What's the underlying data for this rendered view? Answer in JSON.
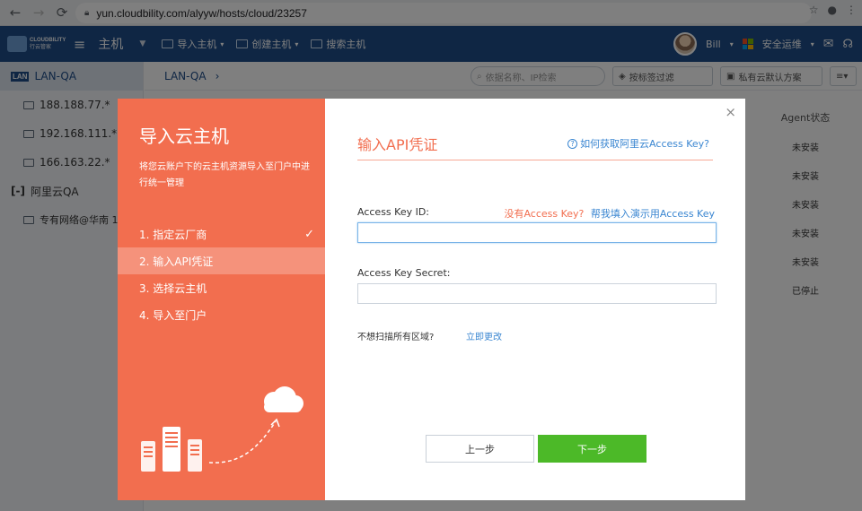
{
  "browser": {
    "url": "yun.cloudbility.com/alyyw/hosts/cloud/23257"
  },
  "appbar": {
    "logo_text": "CLOUDBILITY",
    "logo_sub": "行云管家",
    "title": "主机",
    "nav": [
      {
        "label": "导入主机"
      },
      {
        "label": "创建主机"
      },
      {
        "label": "搜索主机"
      }
    ],
    "user": "Bill",
    "ops": "安全运维"
  },
  "sidebar": {
    "head": "LAN-QA",
    "head_badge": "LAN",
    "items": [
      {
        "label": "188.188.77.*"
      },
      {
        "label": "192.168.111.*"
      },
      {
        "label": "166.163.22.*"
      }
    ],
    "group": "阿里云QA",
    "group_item": "专有网络@华南 1"
  },
  "main": {
    "crumb": "LAN-QA",
    "crumb_arrow": "›",
    "search_placeholder": "依据名称、IP检索",
    "tag_filter": "按标签过滤",
    "plan_filter": "私有云默认方案",
    "column": "Agent状态",
    "statuses": [
      "未安装",
      "未安装",
      "未安装",
      "未安装",
      "未安装",
      "已停止"
    ]
  },
  "modal": {
    "left_title": "导入云主机",
    "left_desc": "将您云账户下的云主机资源导入至门户中进行统一管理",
    "steps": [
      {
        "label": "1. 指定云厂商",
        "done": true
      },
      {
        "label": "2. 输入API凭证",
        "active": true
      },
      {
        "label": "3. 选择云主机"
      },
      {
        "label": "4. 导入至门户"
      }
    ],
    "check_glyph": "✓",
    "title": "输入API凭证",
    "help_link": "如何获取阿里云Access Key?",
    "access_key_id_label": "Access Key ID:",
    "no_key": "没有Access Key?",
    "fill_demo": "帮我填入演示用Access Key",
    "access_key_secret_label": "Access Key Secret:",
    "region_question": "不想扫描所有区域?",
    "region_link": "立即更改",
    "prev_button": "上一步",
    "next_button": "下一步",
    "close_glyph": "×"
  },
  "colors": {
    "accent_orange": "#f26e4f",
    "appbar_blue": "#1e4d89",
    "link_blue": "#3a86d1",
    "next_green": "#4cb928"
  }
}
